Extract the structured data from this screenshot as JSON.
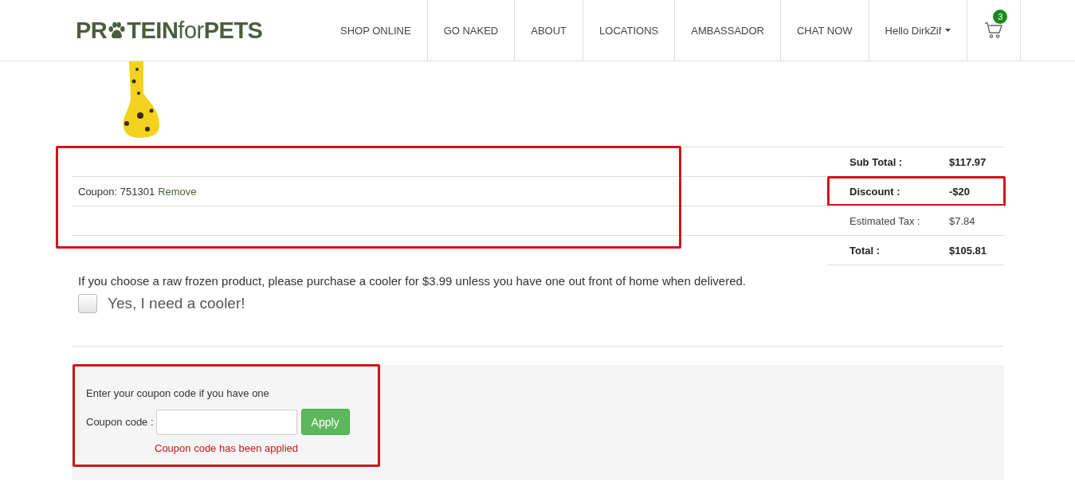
{
  "header": {
    "logo": [
      {
        "kind": "text",
        "text": "PR"
      },
      {
        "kind": "paw"
      },
      {
        "kind": "text",
        "text": "TEIN"
      },
      {
        "kind": "light",
        "text": "for"
      },
      {
        "kind": "text",
        "text": "PETS"
      }
    ],
    "nav": [
      {
        "label": "SHOP ONLINE"
      },
      {
        "label": "GO NAKED"
      },
      {
        "label": "ABOUT"
      },
      {
        "label": "LOCATIONS"
      },
      {
        "label": "AMBASSADOR"
      },
      {
        "label": "CHAT NOW"
      }
    ],
    "user": {
      "label": "Hello DirkZif"
    },
    "cart": {
      "count": "3"
    }
  },
  "totals": {
    "coupon_rows": {
      "highlighted": true,
      "coupon": "Coupon: 751301",
      "remove": "Remove"
    },
    "rows": [
      {
        "label": "Sub Total :",
        "value": "$117.97",
        "bold": true,
        "highlighted": false
      },
      {
        "label": "Discount :",
        "value": "-$20",
        "bold": true,
        "highlighted": true
      },
      {
        "label": "Estimated Tax :",
        "value": "$7.84",
        "bold": false,
        "highlighted": false
      },
      {
        "label": "Total :",
        "value": "$105.81",
        "bold": true,
        "highlighted": false
      }
    ]
  },
  "cooler": {
    "notice": "If you choose a raw frozen product, please purchase a cooler for $3.99 unless you have one out front of home when delivered.",
    "checkbox_label": "Yes, I need a cooler!",
    "checked": false
  },
  "coupon_form": {
    "highlighted": true,
    "intro": "Enter your coupon code if you have one",
    "label": "Coupon code :",
    "button": "Apply",
    "message": "Coupon code has been applied"
  }
}
